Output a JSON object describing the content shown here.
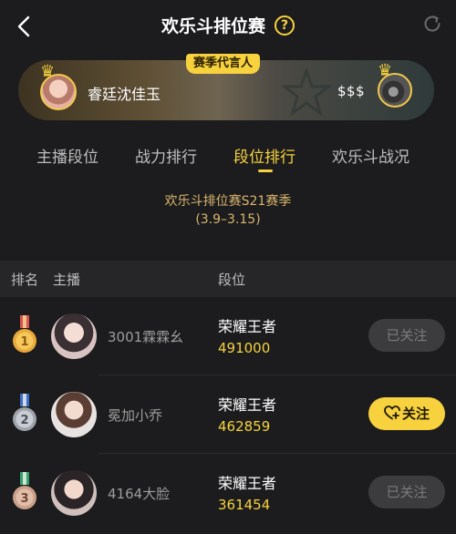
{
  "header": {
    "title": "欢乐斗排位赛",
    "help_label": "?",
    "icons": {
      "back": "back-chevron-icon",
      "help": "help-icon",
      "refresh": "refresh-icon"
    }
  },
  "ambassador": {
    "tag": "赛季代言人",
    "name": "睿廷沈佳玉",
    "reward": "$$$"
  },
  "tabs": [
    {
      "label": "主播段位",
      "active": false
    },
    {
      "label": "战力排行",
      "active": false
    },
    {
      "label": "段位排行",
      "active": true
    },
    {
      "label": "欢乐斗战况",
      "active": false
    }
  ],
  "season": {
    "name": "欢乐斗排位赛S21赛季",
    "dates": "(3.9–3.15)"
  },
  "table": {
    "headers": {
      "rank": "排名",
      "host": "主播",
      "tier": "段位"
    },
    "rows": [
      {
        "rank": "1",
        "name": "3001霖霖幺",
        "tier": "荣耀王者",
        "score": "491000",
        "follow_label": "已关注",
        "followed": true
      },
      {
        "rank": "2",
        "name": "冕加小乔",
        "tier": "荣耀王者",
        "score": "462859",
        "follow_label": "关注",
        "followed": false
      },
      {
        "rank": "3",
        "name": "4164大脸",
        "tier": "荣耀王者",
        "score": "361454",
        "follow_label": "已关注",
        "followed": true
      }
    ]
  },
  "colors": {
    "accent": "#f7d23e",
    "background": "#1c1c1e",
    "season_text": "#d9b56d",
    "medal_gold": "#e8a93a",
    "medal_silver": "#9ea3ab",
    "medal_bronze": "#c9a08a"
  }
}
